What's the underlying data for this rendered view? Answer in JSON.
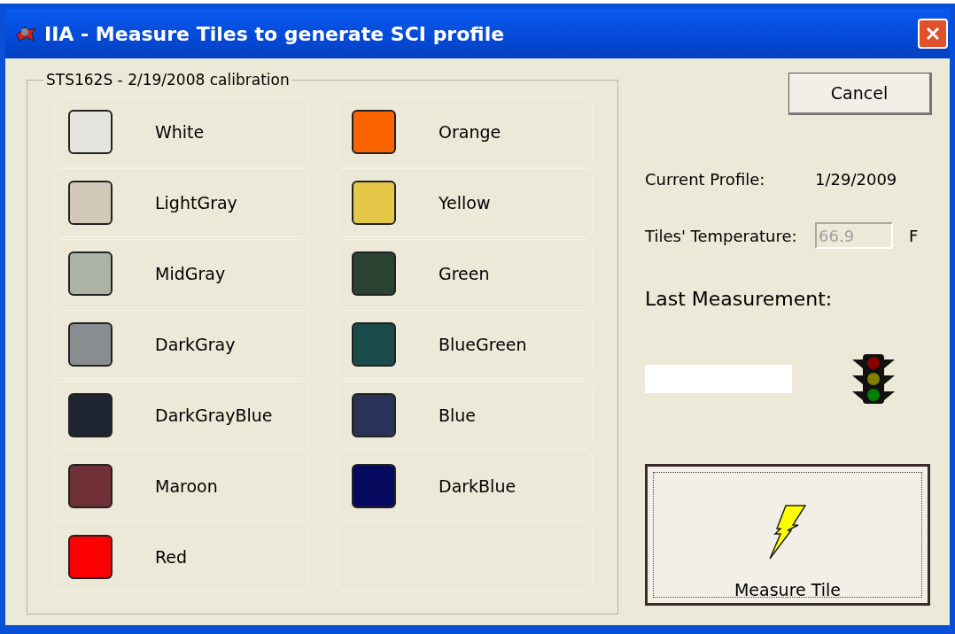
{
  "window": {
    "title": "IIA - Measure Tiles to generate SCI profile"
  },
  "calibration_group": {
    "caption": "STS162S - 2/19/2008 calibration",
    "tiles": [
      {
        "label": "White",
        "color": "#e6e4df"
      },
      {
        "label": "LightGray",
        "color": "#d2c8b8"
      },
      {
        "label": "MidGray",
        "color": "#acb3a4"
      },
      {
        "label": "DarkGray",
        "color": "#8a8d90"
      },
      {
        "label": "DarkGrayBlue",
        "color": "#1e2430"
      },
      {
        "label": "Maroon",
        "color": "#6e3036"
      },
      {
        "label": "Red",
        "color": "#fb0000"
      },
      {
        "label": "Orange",
        "color": "#fb6400"
      },
      {
        "label": "Yellow",
        "color": "#e6c848"
      },
      {
        "label": "Green",
        "color": "#2a4232"
      },
      {
        "label": "BlueGreen",
        "color": "#1a4a4a"
      },
      {
        "label": "Blue",
        "color": "#2a3258"
      },
      {
        "label": "DarkBlue",
        "color": "#060a5e"
      }
    ]
  },
  "cancel_button": "Cancel",
  "current_profile": {
    "label": "Current Profile:",
    "value": "1/29/2009"
  },
  "temperature": {
    "label": "Tiles' Temperature:",
    "value": "66.9",
    "unit": "F",
    "disabled": true
  },
  "last_measurement": {
    "label": "Last Measurement:"
  },
  "measure_button": "Measure Tile"
}
